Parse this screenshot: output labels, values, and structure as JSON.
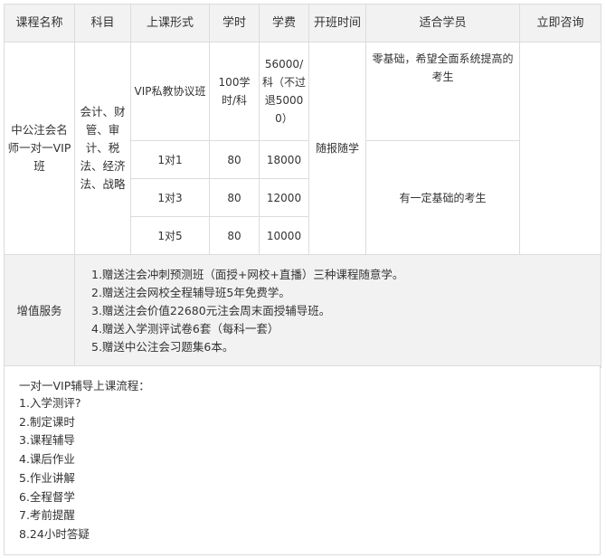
{
  "headers": [
    "课程名称",
    "科目",
    "上课形式",
    "学时",
    "学费",
    "开班时间",
    "适合学员",
    "立即咨询"
  ],
  "course": {
    "name": "中公注会名师一对一VIP班",
    "subjects": "会计、财管、审计、税法、经济法、战略",
    "open_time": "随报随学",
    "rows": [
      {
        "form": "VIP私教协议班",
        "hours": "100学时/科",
        "fee": "56000/科（不过退50000）"
      },
      {
        "form": "1对1",
        "hours": "80",
        "fee": "18000"
      },
      {
        "form": "1对3",
        "hours": "80",
        "fee": "12000"
      },
      {
        "form": "1对5",
        "hours": "80",
        "fee": "10000"
      }
    ],
    "audience": [
      "零基础，希望全面系统提高的考生",
      "有一定基础的考生"
    ]
  },
  "services": {
    "label": "增值服务",
    "items": [
      "1.赠送注会冲刺预测班（面授+网校+直播）三种课程随意学。",
      "2.赠送注会网校全程辅导班5年免费学。",
      "3.赠送注会价值22680元注会周末面授辅导班。",
      "4.赠送入学测评试卷6套（每科一套）",
      "5.赠送中公注会习题集6本。"
    ]
  },
  "flow": {
    "title": "一对一VIP辅导上课流程：",
    "steps": [
      "1.入学测评?",
      "2.制定课时",
      "3.课程辅导",
      "4.课后作业",
      "5.作业讲解",
      "6.全程督学",
      "7.考前提醒",
      "8.24小时答疑"
    ]
  }
}
